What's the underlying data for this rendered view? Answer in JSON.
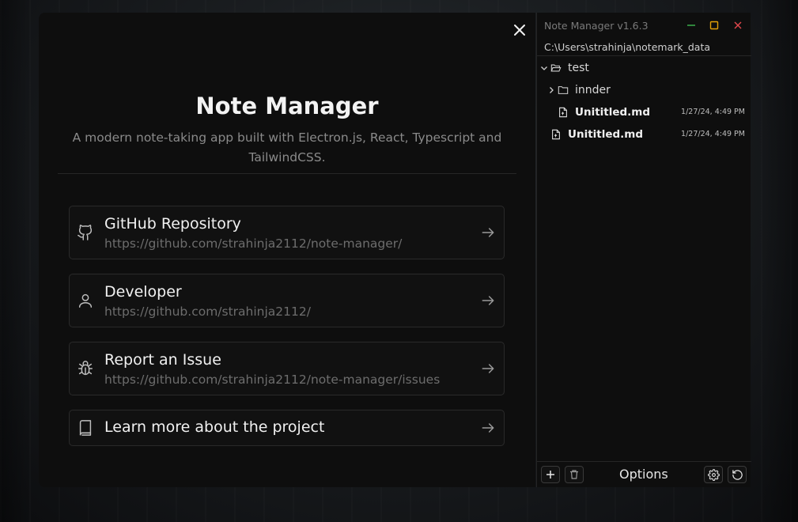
{
  "modal": {
    "title": "Note Manager",
    "subtitle": "A modern note-taking app built with Electron.js, React, Typescript and TailwindCSS.",
    "links": [
      {
        "title": "GitHub Repository",
        "url": "https://github.com/strahinja2112/note-manager/",
        "icon": "github-icon"
      },
      {
        "title": "Developer",
        "url": "https://github.com/strahinja2112/",
        "icon": "user-icon"
      },
      {
        "title": "Report an Issue",
        "url": "https://github.com/strahinja2112/note-manager/issues",
        "icon": "bug-icon"
      },
      {
        "title": "Learn more about the project",
        "icon": "book-icon"
      }
    ]
  },
  "sidebar": {
    "app_title": "Note Manager v1.6.3",
    "path": "C:\\Users\\strahinja\\notemark_data",
    "tree": [
      {
        "type": "folder",
        "name": "test",
        "expanded": true
      },
      {
        "type": "folder",
        "name": "innder",
        "expanded": false
      },
      {
        "type": "file",
        "name": "Unititled.md",
        "timestamp": "1/27/24, 4:49 PM"
      },
      {
        "type": "file",
        "name": "Unititled.md",
        "timestamp": "1/27/24, 4:49 PM"
      }
    ],
    "footer": {
      "options_label": "Options"
    }
  },
  "colors": {
    "minimize": "#3fb950",
    "maximize": "#e3a008",
    "close": "#e5484d"
  }
}
